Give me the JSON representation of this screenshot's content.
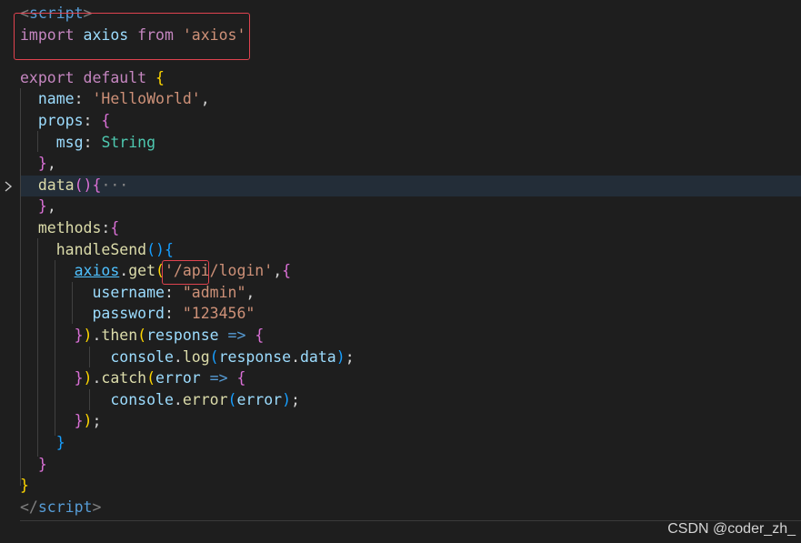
{
  "theme": {
    "background": "#1e1e1e",
    "current_line": "#232d38",
    "annotation_box": "#e0434f"
  },
  "code": {
    "lines": [
      {
        "tokens": [
          {
            "t": "<",
            "c": "#808080"
          },
          {
            "t": "script",
            "c": "#569cd6"
          },
          {
            "t": ">",
            "c": "#808080"
          }
        ]
      },
      {
        "tokens": [
          {
            "t": "import",
            "c": "#c586c0"
          },
          {
            "t": " ",
            "c": "#d4d4d4"
          },
          {
            "t": "axios",
            "c": "#9cdcfe"
          },
          {
            "t": " ",
            "c": "#d4d4d4"
          },
          {
            "t": "from",
            "c": "#c586c0"
          },
          {
            "t": " ",
            "c": "#d4d4d4"
          },
          {
            "t": "'axios'",
            "c": "#ce9178"
          }
        ]
      },
      {
        "tokens": []
      },
      {
        "tokens": [
          {
            "t": "export",
            "c": "#c586c0"
          },
          {
            "t": " ",
            "c": "#d4d4d4"
          },
          {
            "t": "default",
            "c": "#c586c0"
          },
          {
            "t": " ",
            "c": "#d4d4d4"
          },
          {
            "t": "{",
            "c": "#ffd700"
          }
        ]
      },
      {
        "tokens": [
          {
            "t": "  ",
            "c": "#d4d4d4"
          },
          {
            "t": "name",
            "c": "#9cdcfe"
          },
          {
            "t": ": ",
            "c": "#d4d4d4"
          },
          {
            "t": "'HelloWorld'",
            "c": "#ce9178"
          },
          {
            "t": ",",
            "c": "#d4d4d4"
          }
        ]
      },
      {
        "tokens": [
          {
            "t": "  ",
            "c": "#d4d4d4"
          },
          {
            "t": "props",
            "c": "#9cdcfe"
          },
          {
            "t": ": ",
            "c": "#d4d4d4"
          },
          {
            "t": "{",
            "c": "#da70d6"
          }
        ]
      },
      {
        "tokens": [
          {
            "t": "    ",
            "c": "#d4d4d4"
          },
          {
            "t": "msg",
            "c": "#9cdcfe"
          },
          {
            "t": ": ",
            "c": "#d4d4d4"
          },
          {
            "t": "String",
            "c": "#4ec9b0"
          }
        ]
      },
      {
        "tokens": [
          {
            "t": "  ",
            "c": "#d4d4d4"
          },
          {
            "t": "}",
            "c": "#da70d6"
          },
          {
            "t": ",",
            "c": "#d4d4d4"
          }
        ]
      },
      {
        "tokens": [
          {
            "t": "  ",
            "c": "#d4d4d4"
          },
          {
            "t": "data",
            "c": "#dcdcaa"
          },
          {
            "t": "()",
            "c": "#da70d6"
          },
          {
            "t": "{",
            "c": "#da70d6"
          },
          {
            "t": "···",
            "c": "#858585"
          }
        ]
      },
      {
        "tokens": [
          {
            "t": "  ",
            "c": "#d4d4d4"
          },
          {
            "t": "}",
            "c": "#da70d6"
          },
          {
            "t": ",",
            "c": "#d4d4d4"
          }
        ]
      },
      {
        "tokens": [
          {
            "t": "  ",
            "c": "#d4d4d4"
          },
          {
            "t": "methods",
            "c": "#dcdcaa"
          },
          {
            "t": ":",
            "c": "#d4d4d4"
          },
          {
            "t": "{",
            "c": "#da70d6"
          }
        ]
      },
      {
        "tokens": [
          {
            "t": "    ",
            "c": "#d4d4d4"
          },
          {
            "t": "handleSend",
            "c": "#dcdcaa"
          },
          {
            "t": "()",
            "c": "#179fff"
          },
          {
            "t": "{",
            "c": "#179fff"
          }
        ]
      },
      {
        "tokens": [
          {
            "t": "      ",
            "c": "#d4d4d4"
          },
          {
            "t": "axios",
            "c": "#4fc1ff",
            "u": true
          },
          {
            "t": ".",
            "c": "#d4d4d4"
          },
          {
            "t": "get",
            "c": "#dcdcaa"
          },
          {
            "t": "(",
            "c": "#ffd700"
          },
          {
            "t": "'/api/login'",
            "c": "#ce9178"
          },
          {
            "t": ",",
            "c": "#d4d4d4"
          },
          {
            "t": "{",
            "c": "#da70d6"
          }
        ]
      },
      {
        "tokens": [
          {
            "t": "        ",
            "c": "#d4d4d4"
          },
          {
            "t": "username",
            "c": "#9cdcfe"
          },
          {
            "t": ": ",
            "c": "#d4d4d4"
          },
          {
            "t": "\"admin\"",
            "c": "#ce9178"
          },
          {
            "t": ",",
            "c": "#d4d4d4"
          }
        ]
      },
      {
        "tokens": [
          {
            "t": "        ",
            "c": "#d4d4d4"
          },
          {
            "t": "password",
            "c": "#9cdcfe"
          },
          {
            "t": ": ",
            "c": "#d4d4d4"
          },
          {
            "t": "\"123456\"",
            "c": "#ce9178"
          }
        ]
      },
      {
        "tokens": [
          {
            "t": "      ",
            "c": "#d4d4d4"
          },
          {
            "t": "}",
            "c": "#da70d6"
          },
          {
            "t": ")",
            "c": "#ffd700"
          },
          {
            "t": ".",
            "c": "#d4d4d4"
          },
          {
            "t": "then",
            "c": "#dcdcaa"
          },
          {
            "t": "(",
            "c": "#ffd700"
          },
          {
            "t": "response",
            "c": "#9cdcfe"
          },
          {
            "t": " ",
            "c": "#d4d4d4"
          },
          {
            "t": "=>",
            "c": "#569cd6"
          },
          {
            "t": " ",
            "c": "#d4d4d4"
          },
          {
            "t": "{",
            "c": "#da70d6"
          }
        ]
      },
      {
        "tokens": [
          {
            "t": "          ",
            "c": "#d4d4d4"
          },
          {
            "t": "console",
            "c": "#9cdcfe"
          },
          {
            "t": ".",
            "c": "#d4d4d4"
          },
          {
            "t": "log",
            "c": "#dcdcaa"
          },
          {
            "t": "(",
            "c": "#179fff"
          },
          {
            "t": "response",
            "c": "#9cdcfe"
          },
          {
            "t": ".",
            "c": "#d4d4d4"
          },
          {
            "t": "data",
            "c": "#9cdcfe"
          },
          {
            "t": ")",
            "c": "#179fff"
          },
          {
            "t": ";",
            "c": "#d4d4d4"
          }
        ]
      },
      {
        "tokens": [
          {
            "t": "      ",
            "c": "#d4d4d4"
          },
          {
            "t": "}",
            "c": "#da70d6"
          },
          {
            "t": ")",
            "c": "#ffd700"
          },
          {
            "t": ".",
            "c": "#d4d4d4"
          },
          {
            "t": "catch",
            "c": "#dcdcaa"
          },
          {
            "t": "(",
            "c": "#ffd700"
          },
          {
            "t": "error",
            "c": "#9cdcfe"
          },
          {
            "t": " ",
            "c": "#d4d4d4"
          },
          {
            "t": "=>",
            "c": "#569cd6"
          },
          {
            "t": " ",
            "c": "#d4d4d4"
          },
          {
            "t": "{",
            "c": "#da70d6"
          }
        ]
      },
      {
        "tokens": [
          {
            "t": "          ",
            "c": "#d4d4d4"
          },
          {
            "t": "console",
            "c": "#9cdcfe"
          },
          {
            "t": ".",
            "c": "#d4d4d4"
          },
          {
            "t": "error",
            "c": "#dcdcaa"
          },
          {
            "t": "(",
            "c": "#179fff"
          },
          {
            "t": "error",
            "c": "#9cdcfe"
          },
          {
            "t": ")",
            "c": "#179fff"
          },
          {
            "t": ";",
            "c": "#d4d4d4"
          }
        ]
      },
      {
        "tokens": [
          {
            "t": "      ",
            "c": "#d4d4d4"
          },
          {
            "t": "}",
            "c": "#da70d6"
          },
          {
            "t": ")",
            "c": "#ffd700"
          },
          {
            "t": ";",
            "c": "#d4d4d4"
          }
        ]
      },
      {
        "tokens": [
          {
            "t": "    ",
            "c": "#d4d4d4"
          },
          {
            "t": "}",
            "c": "#179fff"
          }
        ]
      },
      {
        "tokens": [
          {
            "t": "  ",
            "c": "#d4d4d4"
          },
          {
            "t": "}",
            "c": "#da70d6"
          }
        ]
      },
      {
        "tokens": [
          {
            "t": "}",
            "c": "#ffd700"
          }
        ]
      },
      {
        "tokens": [
          {
            "t": "</",
            "c": "#808080"
          },
          {
            "t": "script",
            "c": "#569cd6"
          },
          {
            "t": ">",
            "c": "#808080"
          }
        ]
      }
    ]
  },
  "watermark": "CSDN @coder_zh_"
}
